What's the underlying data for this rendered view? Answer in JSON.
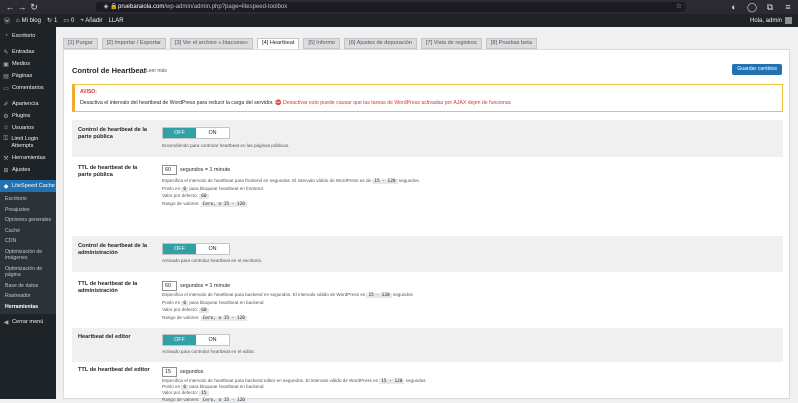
{
  "browser": {
    "url_host": "pruebaraiola.com",
    "url_path": "/wp-admin/admin.php?page=litespeed-toolbox"
  },
  "adminbar": {
    "site_name": "Mi blog",
    "updates_count": "1",
    "comments_count": "0",
    "new_label": "+ Añadir",
    "llar_label": "LLAR",
    "greeting": "Hola, admin"
  },
  "sidebar": {
    "items": [
      {
        "label": "Escritorio",
        "icon": "dashboard-icon"
      },
      {
        "label": "Entradas",
        "icon": "pin-icon"
      },
      {
        "label": "Medios",
        "icon": "media-icon"
      },
      {
        "label": "Páginas",
        "icon": "pages-icon"
      },
      {
        "label": "Comentarios",
        "icon": "comments-icon"
      },
      {
        "label": "Apariencia",
        "icon": "brush-icon"
      },
      {
        "label": "Plugins",
        "icon": "plugin-icon"
      },
      {
        "label": "Usuarios",
        "icon": "users-icon"
      },
      {
        "label": "Limit Login Attempts",
        "icon": "lock-icon"
      },
      {
        "label": "Herramientas",
        "icon": "wrench-icon"
      },
      {
        "label": "Ajustes",
        "icon": "settings-icon"
      },
      {
        "label": "LiteSpeed Cache",
        "icon": "litespeed-icon"
      }
    ],
    "submenu": [
      "Escritorio",
      "Preajustes",
      "Opciones generales",
      "Caché",
      "CDN",
      "Optimización de imágenes",
      "Optimización de página",
      "Base de datos",
      "Rastreador",
      "Herramientas"
    ],
    "collapse_label": "Cerrar menú"
  },
  "tabs": [
    "[1] Purgar",
    "[2] Importar / Exportar",
    "[3] Ver el archivo «.htaccess»",
    "[4] Heartbeat",
    "[5] Informe",
    "[6] Ajustes de depuración",
    "[7] Vista de registros",
    "[8] Pruebas beta"
  ],
  "panel": {
    "title": "Control de Heartbeat",
    "learn_more": "Leer más",
    "save_label": "Guardar cambios"
  },
  "notice": {
    "title": "AVISO:",
    "text": "Desactiva el intervalo del heartbeat de WordPress para reducir la carga del servidor.",
    "warning": "Desactivar esto puede causar que las tareas de WordPress activadas por AJAX dejen de funcionar."
  },
  "settings": {
    "frontend_control": {
      "label": "Control de heartbeat de la parte pública",
      "off": "OFF",
      "on": "ON",
      "desc": "Encendiendo para controlar heartbeat en las páginas públicas."
    },
    "frontend_ttl": {
      "label": "TTL de heartbeat de la parte pública",
      "value": "60",
      "suffix": "segundos = 1 minute",
      "desc1_a": "Especifica el intervalo de heartbeat para frontend en segundos. El intervalo válido de WordPress es de",
      "desc1_b": "15 - 120",
      "desc1_c": "segundos.",
      "desc2_a": "Ponlo en",
      "desc2_b": "0",
      "desc2_c": "para bloquear heartbeat en frontend.",
      "default_label": "Valor por defecto:",
      "default_value": "60",
      "range_label": "Rango de valores:",
      "range_value": "Cero, o 15 - 120"
    },
    "backend_control": {
      "label": "Control de heartbeat de la administración",
      "off": "OFF",
      "on": "ON",
      "desc": "Activado para controlar heartbeat en el escritorio."
    },
    "backend_ttl": {
      "label": "TTL de heartbeat de la administración",
      "value": "60",
      "suffix": "segundos = 1 minute",
      "desc1_a": "Especifica el intervalo de heartbeat para backend en segundos. El intervalo válido de WordPress es",
      "desc1_b": "15 - 120",
      "desc1_c": "segundos",
      "desc2_a": "Ponlo en",
      "desc2_b": "0",
      "desc2_c": "para bloquear heartbeat en backend.",
      "default_label": "Valor por defecto:",
      "default_value": "60",
      "range_label": "Rango de valores:",
      "range_value": "Cero, o 15 - 120"
    },
    "editor_control": {
      "label": "Heartbeat del editor",
      "off": "OFF",
      "on": "ON",
      "desc": "Activado para controlar heartbeat en el editor."
    },
    "editor_ttl": {
      "label": "TTL de heartbeat del editor",
      "value": "15",
      "suffix": "segundos",
      "desc1_a": "Especifica el intervalo de heartbeat para backend editor en segundos. El intervalo válido de WordPress es",
      "desc1_b": "15 - 120",
      "desc1_c": "segundos",
      "desc2_a": "Ponlo en",
      "desc2_b": "0",
      "desc2_c": "para bloquear heartbeat en backend.",
      "default_label": "Valor por defecto:",
      "default_value": "15",
      "range_label": "Rango de valores:",
      "range_value": "Cero, o 15 - 120"
    }
  },
  "colors": {
    "toggle_off": "#2ea2a6",
    "primary": "#2271b1",
    "sidebar_bg": "#1d2327",
    "warning": "#d63638"
  }
}
